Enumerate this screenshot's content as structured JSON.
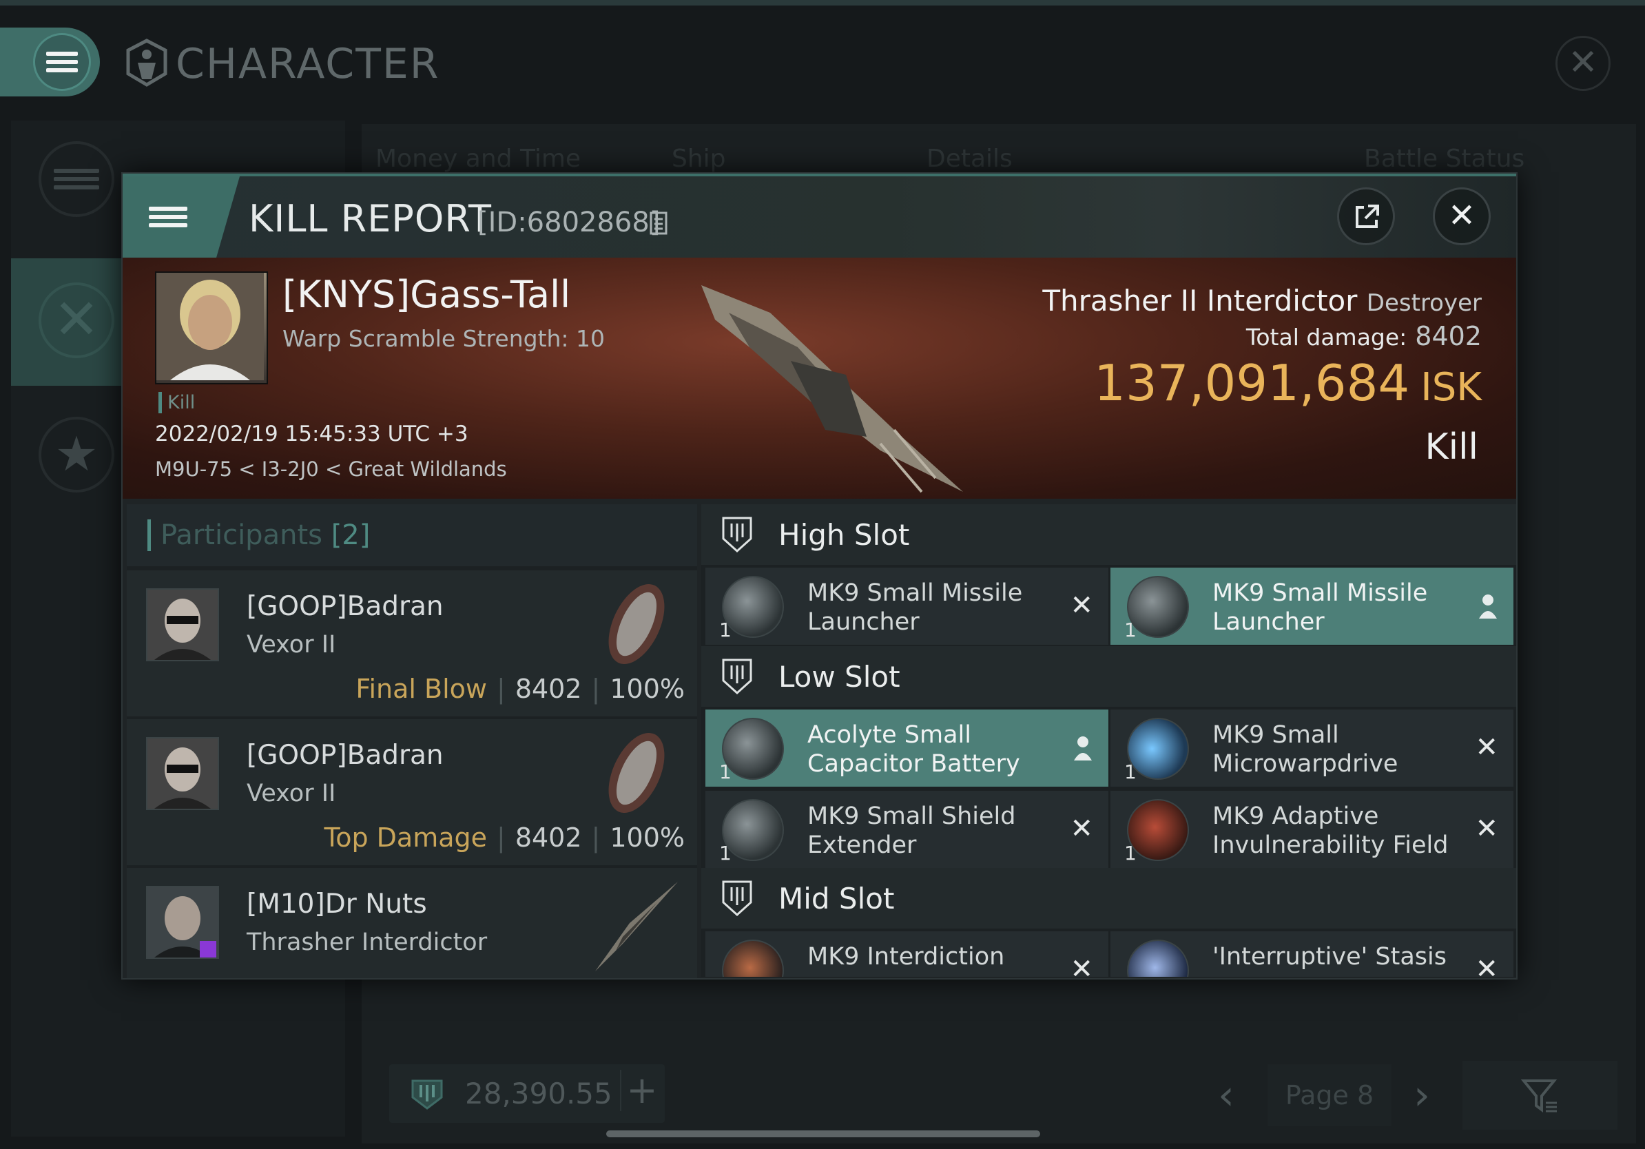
{
  "background": {
    "title": "CHARACTER",
    "tabs": [
      "Money and Time",
      "Ship",
      "Details",
      "Battle Status"
    ],
    "wallet_value": "28,390.55",
    "page_label": "Page 8"
  },
  "dialog": {
    "title": "KILL REPORT",
    "report_id": "[ID:6802868]",
    "victim": {
      "name": "[KNYS]Gass-Tall",
      "warp_scramble": "Warp Scramble Strength: 10",
      "tag": "Kill",
      "datetime": "2022/02/19 15:45:33 UTC +3",
      "location": "M9U-75 < I3-2J0 < Great Wildlands",
      "ship": "Thrasher II Interdictor",
      "ship_class": "Destroyer",
      "total_damage_label": "Total damage:",
      "total_damage": "8402",
      "isk_value": "137,091,684",
      "isk_unit": "ISK",
      "outcome": "Kill"
    },
    "participants": {
      "title": "Participants",
      "count": "[2]",
      "rows": [
        {
          "name": "[GOOP]Badran",
          "ship": "Vexor II",
          "label": "Final Blow",
          "damage": "8402",
          "percent": "100%"
        },
        {
          "name": "[GOOP]Badran",
          "ship": "Vexor II",
          "label": "Top Damage",
          "damage": "8402",
          "percent": "100%"
        },
        {
          "name": "[M10]Dr Nuts",
          "ship": "Thrasher Interdictor",
          "label": "",
          "damage": "",
          "percent": ""
        }
      ]
    },
    "slots": {
      "high": {
        "label": "High Slot",
        "items": [
          {
            "name": "MK9 Small Missile Launcher",
            "qty": "1",
            "state": "destroyed"
          },
          {
            "name": "MK9 Small Missile Launcher",
            "qty": "1",
            "state": "dropped"
          }
        ]
      },
      "low": {
        "label": "Low Slot",
        "items": [
          {
            "name": "Acolyte Small Capacitor Battery",
            "qty": "1",
            "state": "dropped"
          },
          {
            "name": "MK9 Small Microwarpdrive",
            "qty": "1",
            "state": "destroyed"
          },
          {
            "name": "MK9 Small Shield Extender",
            "qty": "1",
            "state": "destroyed"
          },
          {
            "name": "MK9 Adaptive Invulnerability Field",
            "qty": "1",
            "state": "destroyed"
          }
        ]
      },
      "mid": {
        "label": "Mid Slot",
        "items": [
          {
            "name": "MK9 Interdiction",
            "qty": "1",
            "state": "destroyed"
          },
          {
            "name": "'Interruptive' Stasis",
            "qty": "1",
            "state": "destroyed"
          }
        ]
      }
    }
  }
}
